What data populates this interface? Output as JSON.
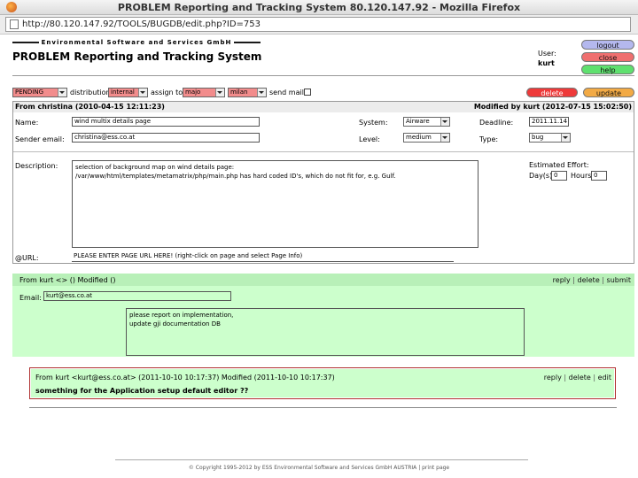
{
  "window": {
    "title": "PROBLEM Reporting and Tracking System 80.120.147.92 - Mozilla Firefox",
    "url": "http://80.120.147.92/TOOLS/BUGDB/edit.php?ID=753"
  },
  "header": {
    "company": "Environmental Software and Services GmbH",
    "app_title": "PROBLEM Reporting and Tracking System",
    "user_label": "User:",
    "user_name": "kurt",
    "buttons": {
      "logout": "logout",
      "close": "close",
      "help": "help"
    }
  },
  "toolbar": {
    "status": "PENDING",
    "distribution_label": "distribution:",
    "distribution": "internal",
    "assign_label": "assign to:",
    "assign_to": "majo",
    "assign_to2": "milan",
    "send_mail_label": "send mail:",
    "delete_label": "delete",
    "update_label": "update"
  },
  "form": {
    "from_line": "From christina (2010-04-15 12:11:23)",
    "modified_line": "Modified by kurt (2012-07-15 15:02:50)",
    "name_label": "Name:",
    "name_value": "wind multix details page",
    "sender_label": "Sender email:",
    "sender_value": "christina@ess.co.at",
    "system_label": "System:",
    "system_value": "Airware",
    "level_label": "Level:",
    "level_value": "medium",
    "deadline_label": "Deadline:",
    "deadline_value": "2011.11.14",
    "type_label": "Type:",
    "type_value": "bug",
    "description_label": "Description:",
    "description_line1": "selection of background map on wind details page:",
    "description_line2": "/var/www/html/templates/metamatrix/php/main.php has hard coded ID's, which do not fit for, e.g. Gulf.",
    "effort_label": "Estimated Effort:",
    "days_label": "Day(s)",
    "days_value": "0",
    "hours_label": "Hours",
    "hours_value": "0",
    "url_label": "@URL:",
    "url_value": "PLEASE ENTER PAGE URL HERE! (right-click on page and select Page Info)"
  },
  "comment_new": {
    "head": "From kurt <> () Modified ()",
    "links": {
      "reply": "reply",
      "delete": "delete",
      "submit": "submit"
    },
    "email_label": "Email:",
    "email_value": "kurt@ess.co.at",
    "text_line1": "please report on implementation,",
    "text_line2": "update gji documentation DB"
  },
  "comment_old": {
    "head": "From kurt <kurt@ess.co.at> (2011-10-10 10:17:37) Modified (2011-10-10 10:17:37)",
    "links": {
      "reply": "reply",
      "delete": "delete",
      "edit": "edit"
    },
    "text": "something for the Application setup default editor ??"
  },
  "footer": {
    "text": "© Copyright 1995-2012 by   ESS   Environmental Software and Services GmbH AUSTRIA",
    "print": "print page"
  },
  "colors": {
    "logout": "#b4b8ee",
    "close": "#ef6f6f",
    "help": "#5fe06f",
    "delete": "#ee3a3a",
    "update": "#f2aa45",
    "status_select": "#f28c8c",
    "comment_bg": "#ccffcc",
    "comment_border": "#b03030"
  }
}
